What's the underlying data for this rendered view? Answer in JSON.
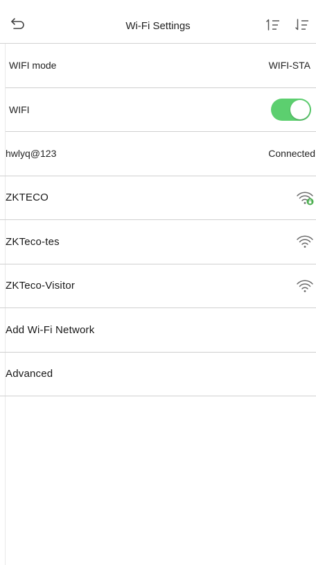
{
  "header": {
    "title": "Wi-Fi Settings",
    "back_icon": "back-arrow-icon",
    "sort_asc_icon": "sort-ascending-icon",
    "sort_desc_icon": "sort-descending-icon"
  },
  "settings": {
    "wifi_mode": {
      "label": "WIFI mode",
      "value": "WIFI-STA"
    },
    "wifi": {
      "label": "WIFI",
      "enabled": true
    }
  },
  "networks": [
    {
      "ssid": "hwlyq@123",
      "status": "Connected"
    },
    {
      "ssid": "ZKTECO",
      "icon": "wifi-locked-icon"
    },
    {
      "ssid": "ZKTeco-tes",
      "icon": "wifi-icon"
    },
    {
      "ssid": "ZKTeco-Visitor",
      "icon": "wifi-icon"
    }
  ],
  "actions": {
    "add_network": "Add Wi-Fi Network",
    "advanced": "Advanced"
  },
  "colors": {
    "toggle_on": "#5ccf6f",
    "lock_badge": "#4caf50",
    "divider": "#cfcfcf"
  }
}
